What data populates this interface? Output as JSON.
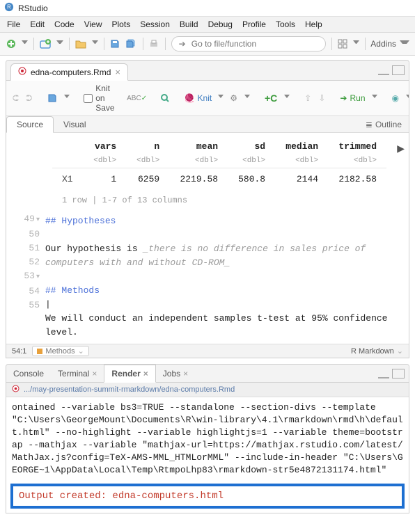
{
  "title": "RStudio",
  "menus": [
    "File",
    "Edit",
    "Code",
    "View",
    "Plots",
    "Session",
    "Build",
    "Debug",
    "Profile",
    "Tools",
    "Help"
  ],
  "goto_placeholder": "Go to file/function",
  "addins_label": "Addins",
  "file_tab": {
    "name": "edna-computers.Rmd"
  },
  "etoolbar": {
    "knit_on_save": "Knit on Save",
    "knit": "Knit",
    "run": "Run",
    "outline": "Outline"
  },
  "src_tabs": {
    "source": "Source",
    "visual": "Visual"
  },
  "table": {
    "headers": [
      "vars",
      "n",
      "mean",
      "sd",
      "median",
      "trimmed"
    ],
    "sub": "<dbl>",
    "rowname": "X1",
    "values": [
      "1",
      "6259",
      "2219.58",
      "580.8",
      "2144",
      "2182.58"
    ],
    "meta": "1 row | 1-7 of 13 columns"
  },
  "lines": {
    "l49": "## Hypotheses",
    "l51a": "Our hypothesis is ",
    "l51b": "_there is no difference in sales price of computers with and without CD-ROM_",
    "l53": "## Methods",
    "l54": "|",
    "l55": "We will conduct an independent samples t-test at 95% confidence level."
  },
  "gutter": [
    "49",
    "50",
    "51",
    "",
    "52",
    "53",
    "54",
    "55"
  ],
  "status": {
    "pos": "54:1",
    "section": "Methods",
    "lang": "R Markdown"
  },
  "bottom": {
    "tabs": [
      "Console",
      "Terminal",
      "Render",
      "Jobs"
    ],
    "active": "Render",
    "path": ".../may-presentation-summit-rmarkdown/edna-computers.Rmd",
    "console_text": "ontained --variable bs3=TRUE --standalone --section-divs --template \"C:\\Users\\GeorgeMount\\Documents\\R\\win-library\\4.1\\rmarkdown\\rmd\\h\\default.html\" --no-highlight --variable highlightjs=1 --variable theme=bootstrap --mathjax --variable \"mathjax-url=https://mathjax.rstudio.com/latest/MathJax.js?config=TeX-AMS-MML_HTMLorMML\" --include-in-header \"C:\\Users\\GEORGE~1\\AppData\\Local\\Temp\\RtmpoLhp83\\rmarkdown-str5e4872131174.html\"",
    "output": "Output created: edna-computers.html"
  }
}
